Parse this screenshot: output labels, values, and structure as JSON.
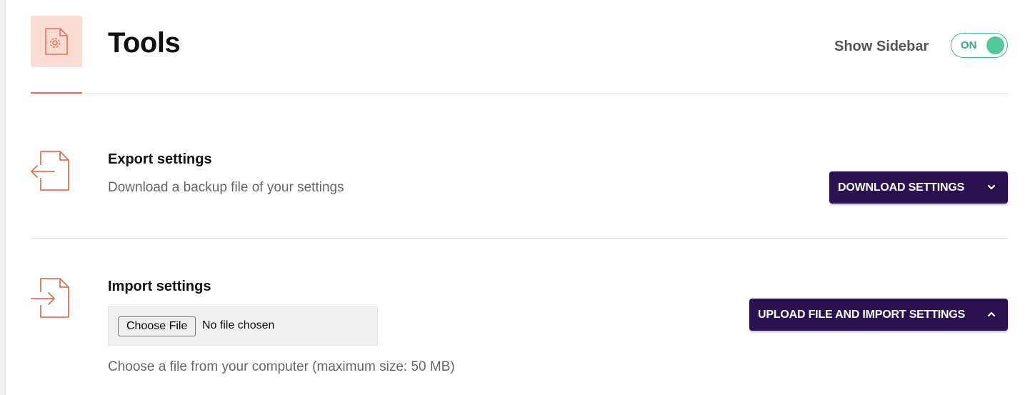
{
  "header": {
    "title": "Tools",
    "icon": "gear-document-icon",
    "show_sidebar_label": "Show Sidebar",
    "toggle_state": "ON"
  },
  "export": {
    "icon": "file-export-icon",
    "title": "Export settings",
    "description": "Download a backup file of your settings",
    "button_label": "DOWNLOAD SETTINGS",
    "button_icon": "chevron-down-icon"
  },
  "import": {
    "icon": "file-import-icon",
    "title": "Import settings",
    "choose_file_label": "Choose File",
    "file_status": "No file chosen",
    "hint": "Choose a file from your computer (maximum size: 50 MB)",
    "button_label": "UPLOAD FILE AND IMPORT SETTINGS",
    "button_icon": "chevron-up-icon"
  },
  "colors": {
    "accent": "#e07259",
    "icon_bg": "#fbdcd3",
    "button_bg": "#2a1150",
    "toggle_green": "#4fc99a"
  }
}
